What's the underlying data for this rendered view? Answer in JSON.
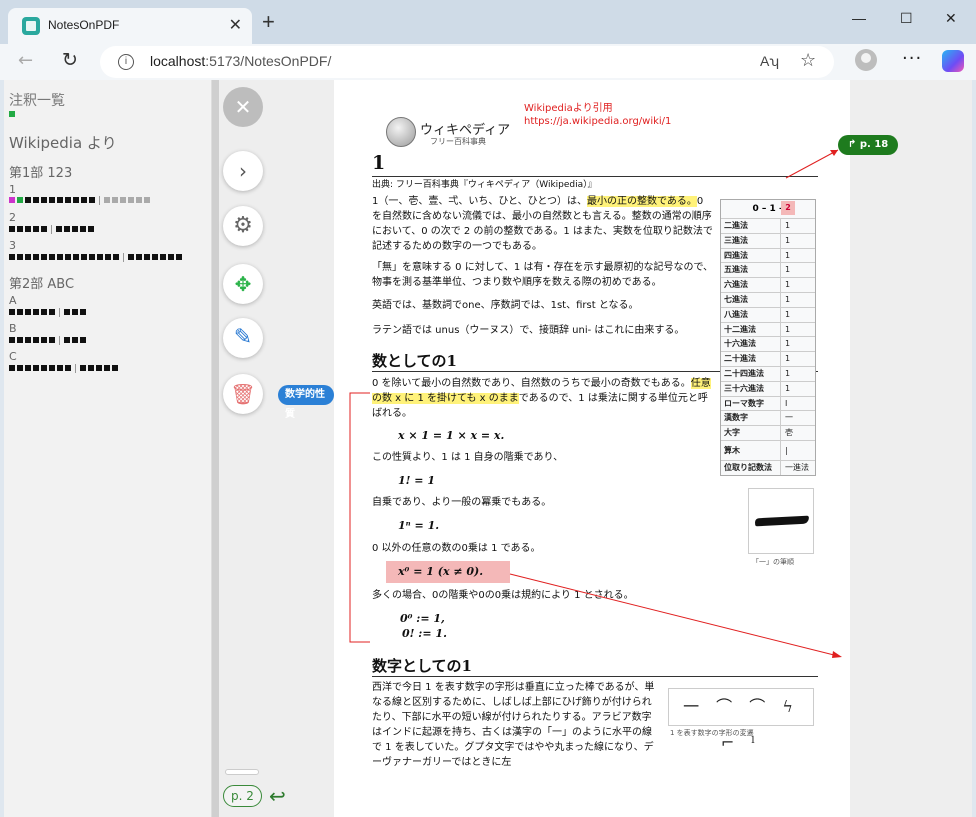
{
  "browser": {
    "tab_title": "NotesOnPDF",
    "tab_close": "✕",
    "new_tab": "+",
    "win_min": "—",
    "win_max": "☐",
    "win_close": "✕",
    "url_host": "localhost",
    "url_rest": ":5173/NotesOnPDF/",
    "read_aloud": "Aʮ"
  },
  "annotations": {
    "heading": "注釈一覧",
    "source": "Wikipedia より",
    "part1": "第1部 123",
    "part2": "第2部 ABC",
    "items": {
      "n1": "1",
      "n2": "2",
      "n3": "3",
      "a": "A",
      "b": "B",
      "c": "C"
    }
  },
  "controls": {
    "label_badge": "数学的性質",
    "page_pill": "p. 2"
  },
  "document": {
    "logo_title": "ウィキペディア",
    "logo_sub": "フリー百科事典",
    "src_note_1": "Wikipediaより引用",
    "src_note_2": "https://ja.wikipedia.org/wiki/1",
    "jump_badge": "p. 18",
    "title": "1",
    "source_line": "出典: フリー百科事典『ウィキペディア（Wikipedia）』",
    "p1_a": "1（一、壱、壹、弌、いち、ひと、ひとつ）は、",
    "p1_hl": "最小の正の整数である。",
    "p1_b": "0 を自然数に含めない流儀では、最小の自然数とも言える。整数の通常の順序において、0 の次で 2 の前の整数である。1 はまた、実数を位取り記数法で記述するための数字の一つでもある。",
    "p2": "「無」を意味する 0 に対して、1 は有・存在を示す最原初的な記号なので、物事を測る基準単位、つまり数や順序を数える際の初めである。",
    "p3": "英語では、基数詞でone、序数詞では、1st、first となる。",
    "p4": "ラテン語では unus（ウーヌス）で、接頭辞 uni- はこれに由来する。",
    "h2_a": "数としての1",
    "s1_a": "0 を除いて最小の自然数であり、自然数のうちで最小の奇数でもある。",
    "s1_hl": "任意の数 x に 1 を掛けても x のまま",
    "s1_b": "であるので、1 は乗法に関する単位元と呼ばれる。",
    "m1": "x × 1 = 1 × x = x.",
    "s2": "この性質より、1 は 1 自身の階乗であり、",
    "m2": "1! = 1",
    "s3": "自乗であり、より一般の冪乗でもある。",
    "m3": "1ⁿ = 1.",
    "s4": "0 以外の任意の数の0乗は 1 である。",
    "m4": "x⁰ = 1      (x ≠ 0).",
    "s5": "多くの場合、0の階乗や0の0乗は規約により 1 とされる。",
    "m5": "0⁰ := 1,",
    "m6": "0! := 1.",
    "h2_b": "数字としての1",
    "d1": "西洋で今日 1 を表す数字の字形は垂直に立った棒であるが、単なる線と区別するために、しばしば上部にひげ飾りが付けられたり、下部に水平の短い線が付けられたりする。アラビア数字はインドに起源を持ち、古くは漢字の「一」のように水平の線で 1 を表していた。グプタ文字ではやや丸まった線になり、デーヴァナーガリーではときに左",
    "img1_cap": "「一」の筆順",
    "img2_glyphs": "一 ⌒ ⌒ ϟ ⌐ ˡ",
    "img2_cap": "1 を表す数字の字形の変遷"
  },
  "infobox": {
    "head_a": "0 – 1 –",
    "head_b": "2",
    "rows": [
      {
        "k": "二進法",
        "v": "1"
      },
      {
        "k": "三進法",
        "v": "1"
      },
      {
        "k": "四進法",
        "v": "1"
      },
      {
        "k": "五進法",
        "v": "1"
      },
      {
        "k": "六進法",
        "v": "1"
      },
      {
        "k": "七進法",
        "v": "1"
      },
      {
        "k": "八進法",
        "v": "1"
      },
      {
        "k": "十二進法",
        "v": "1"
      },
      {
        "k": "十六進法",
        "v": "1"
      },
      {
        "k": "二十進法",
        "v": "1"
      },
      {
        "k": "二十四進法",
        "v": "1"
      },
      {
        "k": "三十六進法",
        "v": "1"
      },
      {
        "k": "ローマ数字",
        "v": "I"
      },
      {
        "k": "漢数字",
        "v": "一"
      },
      {
        "k": "大字",
        "v": "壱"
      },
      {
        "k": "算木",
        "v": "|"
      },
      {
        "k": "位取り記数法",
        "v": "一進法"
      }
    ]
  },
  "colors": {
    "accent_green": "#1e7b1e",
    "label_blue": "#2b80d6",
    "annotation_red": "#e02020",
    "highlight_yellow": "#fff27a",
    "highlight_pink": "#f4b8b8"
  }
}
